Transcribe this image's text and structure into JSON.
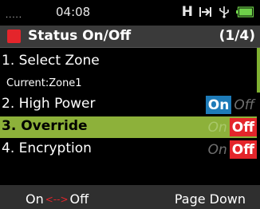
{
  "status_bar": {
    "signal": ".....",
    "time": "04:08",
    "power_mode": "H",
    "icons": [
      "high-power-icon",
      "arrow-to-bar-icon",
      "usb-icon",
      "battery-icon"
    ]
  },
  "header": {
    "title": "Status On/Off",
    "page": "(1/4)",
    "accent_color": "#e4252b"
  },
  "menu": {
    "items": [
      {
        "label": "1. Select Zone"
      },
      {
        "label": "Current:Zone1"
      },
      {
        "label": "2. High Power",
        "on_label": "On",
        "off_label": "Off",
        "state": "On"
      },
      {
        "label": "3. Override",
        "on_label": "On",
        "off_label": "Off",
        "state": "Off"
      },
      {
        "label": "4. Encryption",
        "on_label": "On",
        "off_label": "Off",
        "state": "Off"
      }
    ],
    "selected_index": 3,
    "selected_color": "#8db13a"
  },
  "softkeys": {
    "left_on": "On",
    "left_arrow": "<-->",
    "left_off": "Off",
    "right": "Page Down"
  },
  "scroll": {
    "thumb_color": "#7fb031"
  }
}
